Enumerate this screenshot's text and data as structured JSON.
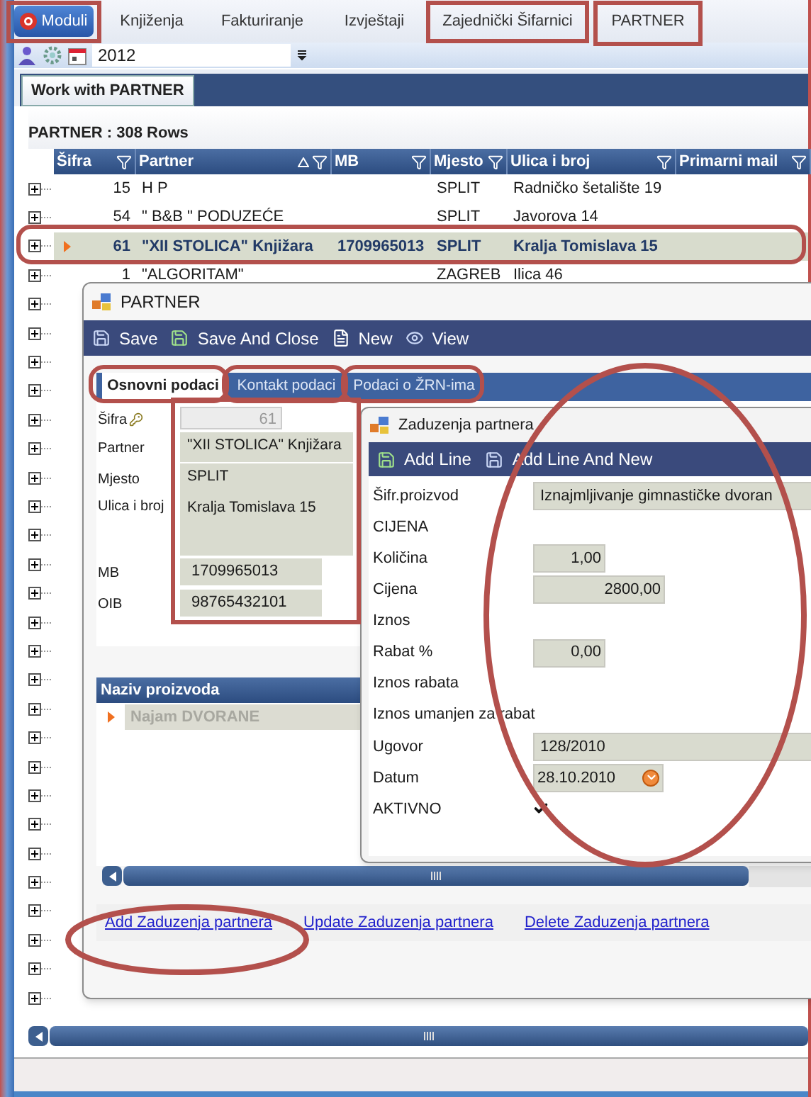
{
  "menu": [
    {
      "label": "Moduli",
      "selected": true
    },
    {
      "label": "Knjiženja",
      "selected": false
    },
    {
      "label": "Fakturiranje",
      "selected": false
    },
    {
      "label": "Izvještaji",
      "selected": false
    },
    {
      "label": "Zajednički Šifarnici",
      "selected": false
    },
    {
      "label": "PARTNER",
      "selected": false
    }
  ],
  "toolbar": {
    "year": "2012"
  },
  "doc_tabs": [
    {
      "label": "Work with PARTNER",
      "selected": true
    }
  ],
  "grid": {
    "caption": "PARTNER : 308 Rows",
    "columns": [
      "Šifra",
      "Partner",
      "MB",
      "Mjesto",
      "Ulica i broj",
      "Primarni mail"
    ],
    "rows": [
      {
        "cells": [
          "15",
          "H P",
          "",
          "SPLIT",
          "Radničko šetalište 19",
          ""
        ],
        "selected": false,
        "expanded": false
      },
      {
        "cells": [
          "54",
          "\" B&B \" PODUZEĆE",
          "",
          "SPLIT",
          "Javorova 14",
          ""
        ],
        "selected": false,
        "expanded": false
      },
      {
        "cells": [
          "61",
          "\"XII STOLICA\" Knjižara",
          "1709965013",
          "SPLIT",
          "Kralja Tomislava 15",
          ""
        ],
        "selected": true,
        "expanded": false
      },
      {
        "cells": [
          "1",
          "\"ALGORITAM\"",
          "",
          "ZAGREB",
          "Ilica 46",
          ""
        ],
        "selected": false,
        "expanded": false
      },
      {
        "expanded": false
      },
      {
        "expanded": false
      },
      {
        "expanded": false
      },
      {
        "expanded": false
      },
      {
        "expanded": false
      },
      {
        "expanded": false
      },
      {
        "expanded": false
      },
      {
        "expanded": false
      },
      {
        "expanded": false
      },
      {
        "expanded": false
      },
      {
        "expanded": false
      },
      {
        "expanded": false
      },
      {
        "expanded": false
      },
      {
        "expanded": false
      },
      {
        "expanded": false
      },
      {
        "expanded": false
      },
      {
        "expanded": false
      },
      {
        "expanded": false
      },
      {
        "expanded": false
      },
      {
        "expanded": false
      },
      {
        "expanded": false
      },
      {
        "expanded": false
      },
      {
        "expanded": false
      },
      {
        "expanded": false
      },
      {
        "expanded": false
      }
    ]
  },
  "partner_dialog": {
    "title": "PARTNER",
    "actions": [
      "Save",
      "Save And Close",
      "New",
      "View"
    ],
    "tabs": [
      {
        "label": "Osnovni podaci",
        "selected": true
      },
      {
        "label": "Kontakt podaci",
        "selected": false
      },
      {
        "label": "Podaci o ŽRN-ima",
        "selected": false
      }
    ],
    "fields": [
      {
        "kind": "key",
        "label": "Šifra",
        "value": "61"
      },
      {
        "kind": "text",
        "label": "Partner",
        "value": "\"XII STOLICA\" Knjižara"
      },
      {
        "kind": "text",
        "label": "Mjesto",
        "value": "SPLIT"
      },
      {
        "kind": "multiline",
        "label": "Ulica i broj",
        "value": "Kralja Tomislava 15"
      },
      {
        "kind": "short",
        "label": "MB",
        "value": "1709965013"
      },
      {
        "kind": "short",
        "label": "OIB",
        "value": "98765432101"
      }
    ],
    "products": {
      "column": "Naziv proizvoda",
      "rows": [
        {
          "name": "Najam DVORANE",
          "selected": true
        }
      ]
    },
    "links": [
      "Add Zaduzenja partnera",
      "Update Zaduzenja partnera",
      "Delete Zaduzenja partnera"
    ]
  },
  "charge_dialog": {
    "title": "Zaduzenja partnera",
    "actions": [
      "Add Line",
      "Add Line And New"
    ],
    "fields": [
      {
        "kind": "wide",
        "label": "Šifr.proizvod",
        "value": "Iznajmljivanje gimnastičke dvoran"
      },
      {
        "kind": "none",
        "label": "CIJENA"
      },
      {
        "kind": "number",
        "label": "Količina",
        "value": "1,00"
      },
      {
        "kind": "amount",
        "label": "Cijena",
        "value": "2800,00"
      },
      {
        "kind": "none",
        "label": "Iznos"
      },
      {
        "kind": "number",
        "label": "Rabat %",
        "value": "0,00"
      },
      {
        "kind": "none",
        "label": "Iznos rabata"
      },
      {
        "kind": "none",
        "label": "Iznos umanjen za rabat"
      },
      {
        "kind": "wide",
        "label": "Ugovor",
        "value": "128/2010"
      },
      {
        "kind": "date",
        "label": "Datum",
        "value": "28.10.2010"
      },
      {
        "kind": "checkbox",
        "label": "AKTIVNO",
        "checked": true
      }
    ]
  },
  "callouts": [
    {
      "kind": "box"
    },
    {
      "kind": "box"
    },
    {
      "kind": "box"
    },
    {
      "kind": "pill"
    },
    {
      "kind": "pill"
    },
    {
      "kind": "pill"
    },
    {
      "kind": "pill"
    },
    {
      "kind": "box"
    },
    {
      "kind": "ellipse"
    },
    {
      "kind": "ellipse"
    }
  ]
}
